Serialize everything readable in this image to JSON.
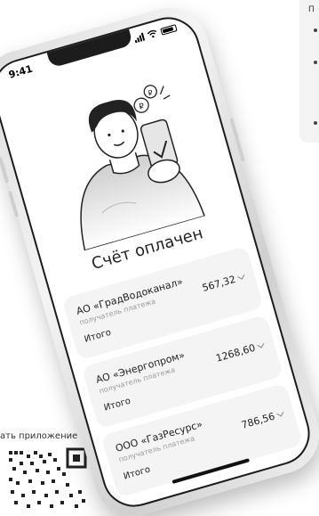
{
  "status_bar": {
    "time": "9:41"
  },
  "screen": {
    "title": "Счёт оплачен",
    "bills": [
      {
        "name": "АО «ГрадВодоканал»",
        "subtitle": "получатель платежа",
        "total_label": "Итого",
        "amount": "567,32"
      },
      {
        "name": "АО «Энергопром»",
        "subtitle": "получатель платежа",
        "total_label": "Итого",
        "amount": "1268,60"
      },
      {
        "name": "ООО «ГазРесурс»",
        "subtitle": "получатель платежа",
        "total_label": "Итого",
        "amount": "786,56"
      }
    ]
  },
  "page": {
    "download_label": "ать приложение",
    "side_card_heading": "П"
  },
  "colors": {
    "card_bg": "#f4f4f4",
    "text": "#222222",
    "muted": "#9a9a9a"
  }
}
